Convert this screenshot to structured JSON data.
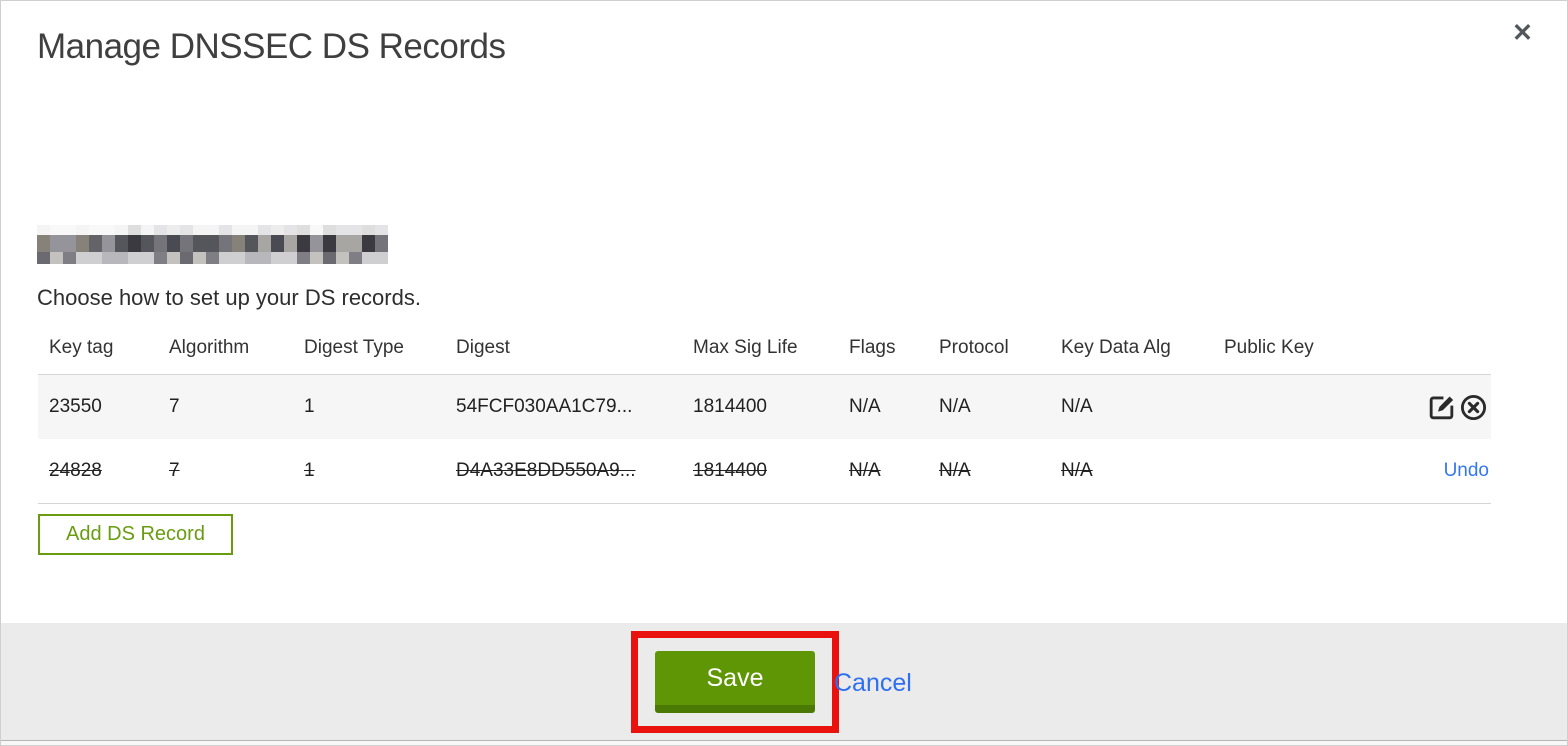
{
  "dialog": {
    "title": "Manage DNSSEC DS Records",
    "close_glyph": "✕",
    "instruction": "Choose how to set up your DS records.",
    "domain": {
      "redacted": true
    }
  },
  "table": {
    "columns": [
      "Key tag",
      "Algorithm",
      "Digest Type",
      "Digest",
      "Max Sig Life",
      "Flags",
      "Protocol",
      "Key Data Alg",
      "Public Key"
    ],
    "rows": [
      {
        "cells": [
          "23550",
          "7",
          "1",
          "54FCF030AA1C79...",
          "1814400",
          "N/A",
          "N/A",
          "N/A",
          ""
        ],
        "deleted": false,
        "actions": [
          "edit",
          "delete"
        ]
      },
      {
        "cells": [
          "24828",
          "7",
          "1",
          "D4A33E8DD550A9...",
          "1814400",
          "N/A",
          "N/A",
          "N/A",
          ""
        ],
        "deleted": true,
        "actions": [
          "undo"
        ]
      }
    ]
  },
  "buttons": {
    "add_ds_record": "Add DS Record",
    "save": "Save",
    "cancel": "Cancel",
    "undo": "Undo"
  },
  "annotation": {
    "type": "red-box",
    "target": "save-button"
  },
  "colors": {
    "button_green": "#5f9605",
    "button_green_dark": "#4a7a04",
    "outline_green": "#699c10",
    "link_blue": "#2d6ff0",
    "annotation_red": "#ea120c",
    "footer_gray": "#ebebeb"
  },
  "redaction_palette": {
    "top": [
      "#f4f4f4",
      "#ececec",
      "#e4e4e6",
      "#f8f8f8",
      "#dededf"
    ],
    "mid": [
      "#3a3a40",
      "#55555c",
      "#2c2c32",
      "#74747a",
      "#94949a",
      "#c0c0c4",
      "#86827a",
      "#4a4a52",
      "#a8a6a2",
      "#646468"
    ],
    "bottom": [
      "#9a9a9e",
      "#b8b8bc",
      "#7e7e84",
      "#cfcfd2",
      "#8c8c90",
      "#6a6a70",
      "#c4c2be"
    ]
  }
}
